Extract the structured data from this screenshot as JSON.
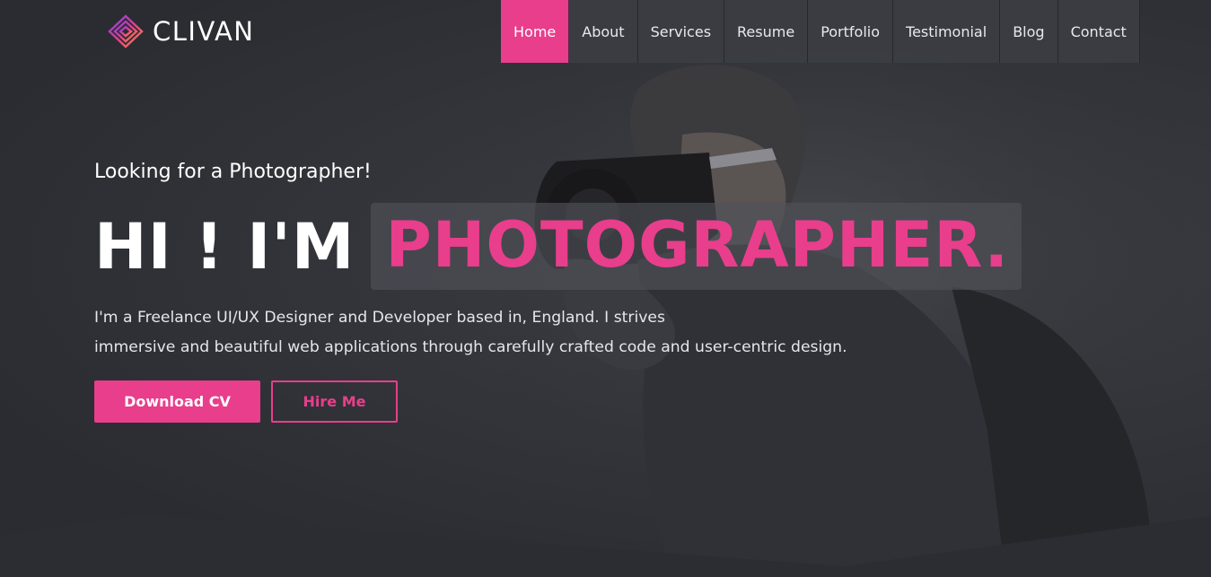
{
  "brand": {
    "name": "CLIVAN",
    "accent": "#e83e8c",
    "logo_gradient": [
      "#7b3fe4",
      "#e83e8c",
      "#f58a3c"
    ]
  },
  "nav": {
    "items": [
      {
        "label": "Home",
        "active": true
      },
      {
        "label": "About"
      },
      {
        "label": "Services"
      },
      {
        "label": "Resume"
      },
      {
        "label": "Portfolio"
      },
      {
        "label": "Testimonial"
      },
      {
        "label": "Blog"
      },
      {
        "label": "Contact"
      }
    ]
  },
  "hero": {
    "kicker": "Looking for a Photographer!",
    "headline_intro": "HI ! I'M",
    "headline_role": "PHOTOGRAPHER.",
    "description_line1": "I'm a Freelance UI/UX Designer and Developer based in, England. I strives",
    "description_line2": "immersive and beautiful web applications through carefully crafted code and user-centric design.",
    "primary_button": "Download CV",
    "secondary_button": "Hire Me"
  }
}
